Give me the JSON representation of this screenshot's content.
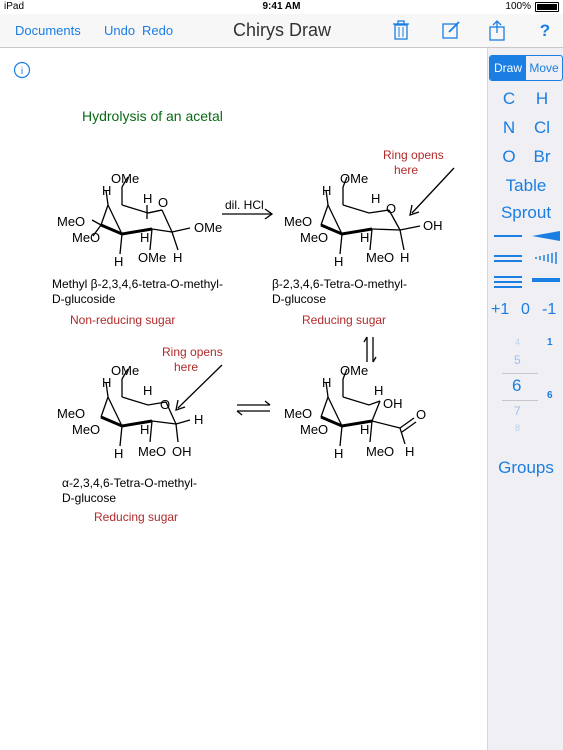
{
  "status": {
    "device": "iPad",
    "time": "9:41 AM",
    "battery": "100%"
  },
  "nav": {
    "documents": "Documents",
    "undo": "Undo",
    "redo": "Redo",
    "title": "Chirys Draw"
  },
  "canvas": {
    "title": "Hydrolysis of an acetal",
    "reagent": "dil. HCl",
    "ring_opens_1": [
      "Ring opens",
      "here"
    ],
    "ring_opens_2": [
      "Ring opens",
      "here"
    ],
    "mol1_name": [
      "Methyl β-2,3,4,6-tetra-O-methyl-",
      "D-glucoside"
    ],
    "mol1_type": "Non-reducing sugar",
    "mol2_name": [
      "β-2,3,4,6-Tetra-O-methyl-",
      "D-glucose"
    ],
    "mol2_type": "Reducing sugar",
    "mol3_name": [
      "α-2,3,4,6-Tetra-O-methyl-",
      "D-glucose"
    ],
    "mol3_type": "Reducing sugar",
    "atoms": {
      "ome": "OMe",
      "meo": "MeO",
      "h": "H",
      "o": "O",
      "oh": "OH"
    }
  },
  "sidebar": {
    "draw": "Draw",
    "move": "Move",
    "elements": [
      "C",
      "H",
      "N",
      "Cl",
      "O",
      "Br"
    ],
    "table": "Table",
    "sprout": "Sprout",
    "charges": [
      "+1",
      "0",
      "-1"
    ],
    "wheel": [
      "4",
      "5",
      "6",
      "7",
      "8"
    ],
    "wheel_left_top": "1",
    "wheel_left_mid": "6",
    "groups": "Groups"
  },
  "colors": {
    "accent": "#1a7ee3",
    "title": "#0a6a14",
    "note": "#b02a2a"
  }
}
